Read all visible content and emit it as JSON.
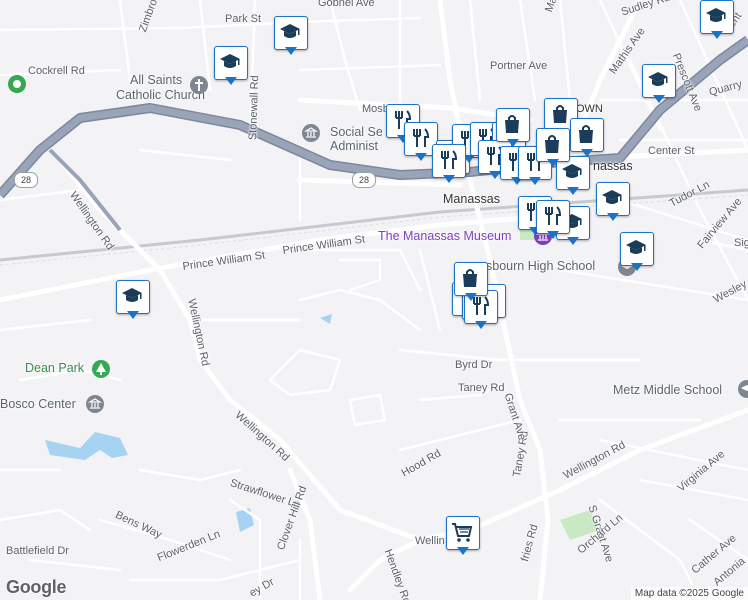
{
  "map": {
    "road_labels": {
      "park_st": "Park St",
      "gobnel_ave": "Gobnel Ave",
      "zimbro_ave": "Zimbro Av",
      "cockrell_rd": "Cockrell Rd",
      "stonewall_rd": "Stonewall Rd",
      "portner_ave": "Portner Ave",
      "mosby_st": "Mosby St",
      "center_st": "Center St",
      "wellington_rd_nw": "Wellington Rd",
      "wellington_rd_w": "Wellington Rd",
      "wellington_rd_c": "Wellington Rd",
      "wellington_rd_e": "Wellington Rd",
      "wellington_rd_s": "Wellin",
      "prince_william_st_1": "Prince William St",
      "prince_william_st_2": "Prince William St",
      "byrd_dr": "Byrd Dr",
      "taney_rd": "Taney Rd",
      "taney_rd_2": "Taney Rd",
      "grant_ave": "Grant Ave",
      "hood_rd": "Hood Rd",
      "strawflower_ln": "Strawflower Ln",
      "clover_hill_rd": "Clover Hill Rd",
      "bens_way": "Bens Way",
      "battlefield_dr": "Battlefield Dr",
      "flowerden_ln": "Flowerden Ln",
      "hendley_rd": "Hendley Rd",
      "mathis_ave": "Mathis Ave",
      "prescott_ave": "Prescott Ave",
      "sudley_rd": "Sudley Rd",
      "tudor_ln": "Tudor Ln",
      "fairview_ave": "Fairview Ave",
      "wesley": "Wesley",
      "virginia_ave": "Virginia Ave",
      "s_grant_ave": "S Grant Ave",
      "orchard_ln": "Orchard Ln",
      "cather_ave": "Cather Ave",
      "antonia": "Antonia",
      "quarry": "Quarry",
      "dumfries_rd": "fries Rd",
      "ey_dr": "ey Dr",
      "sig": "Sig",
      "main": "Main",
      "cent": "Cent",
      "st_small": "St"
    },
    "place_labels": {
      "all_saints_1": "All Saints",
      "all_saints_2": "Catholic Church",
      "social_security_1": "Social Se",
      "social_security_2": "Administ",
      "manassas": "Manassas",
      "manassas_museum": "The Manassas Museum",
      "osbourn_high": "sbourn High School",
      "metz_middle": "Metz Middle School",
      "dean_park": "Dean Park",
      "bosco_center": "Bosco Center",
      "old_town": "OLD TOWN",
      "nassas_small": "nassas"
    },
    "shields": {
      "route_28_west": "28",
      "route_28_center": "28"
    },
    "icons": {
      "school": "school-icon",
      "restaurant": "restaurant-icon",
      "shopping": "shopping-bag-icon",
      "grocery": "shopping-cart-icon",
      "church": "church-icon",
      "government": "government-icon",
      "park": "park-icon",
      "museum": "museum-icon"
    },
    "colors": {
      "background": "#f3f3f6",
      "road": "#ffffff",
      "highway": "#9aa4b8",
      "highway_border": "#7c879c",
      "water": "#a7d3f2",
      "park": "#c9e9c4",
      "pin_border": "#1a73c8",
      "icon_color": "#1c3d5a",
      "museum": "#7b3fbf"
    },
    "attribution": "Map data ©2025 Google",
    "logo": "Google"
  }
}
